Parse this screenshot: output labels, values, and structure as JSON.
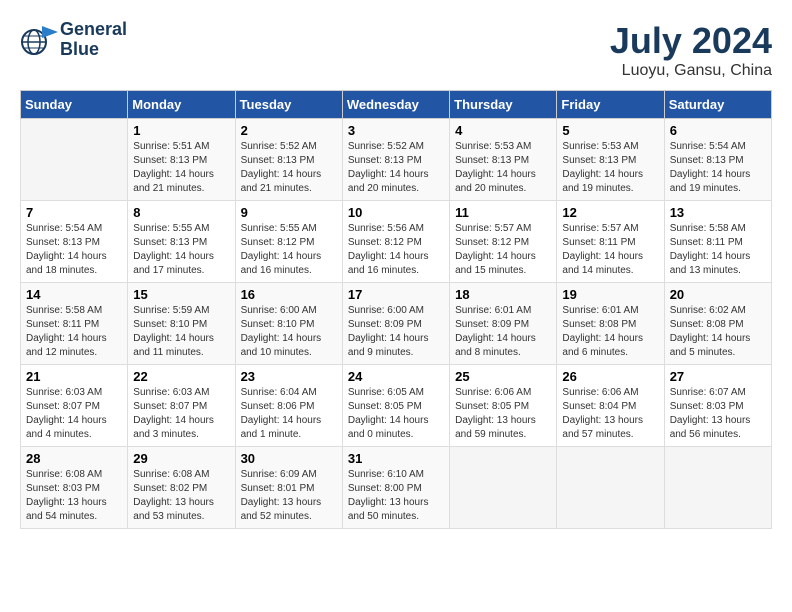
{
  "header": {
    "logo_line1": "General",
    "logo_line2": "Blue",
    "month": "July 2024",
    "location": "Luoyu, Gansu, China"
  },
  "weekdays": [
    "Sunday",
    "Monday",
    "Tuesday",
    "Wednesday",
    "Thursday",
    "Friday",
    "Saturday"
  ],
  "weeks": [
    [
      {
        "day": "",
        "info": ""
      },
      {
        "day": "1",
        "info": "Sunrise: 5:51 AM\nSunset: 8:13 PM\nDaylight: 14 hours\nand 21 minutes."
      },
      {
        "day": "2",
        "info": "Sunrise: 5:52 AM\nSunset: 8:13 PM\nDaylight: 14 hours\nand 21 minutes."
      },
      {
        "day": "3",
        "info": "Sunrise: 5:52 AM\nSunset: 8:13 PM\nDaylight: 14 hours\nand 20 minutes."
      },
      {
        "day": "4",
        "info": "Sunrise: 5:53 AM\nSunset: 8:13 PM\nDaylight: 14 hours\nand 20 minutes."
      },
      {
        "day": "5",
        "info": "Sunrise: 5:53 AM\nSunset: 8:13 PM\nDaylight: 14 hours\nand 19 minutes."
      },
      {
        "day": "6",
        "info": "Sunrise: 5:54 AM\nSunset: 8:13 PM\nDaylight: 14 hours\nand 19 minutes."
      }
    ],
    [
      {
        "day": "7",
        "info": "Sunrise: 5:54 AM\nSunset: 8:13 PM\nDaylight: 14 hours\nand 18 minutes."
      },
      {
        "day": "8",
        "info": "Sunrise: 5:55 AM\nSunset: 8:13 PM\nDaylight: 14 hours\nand 17 minutes."
      },
      {
        "day": "9",
        "info": "Sunrise: 5:55 AM\nSunset: 8:12 PM\nDaylight: 14 hours\nand 16 minutes."
      },
      {
        "day": "10",
        "info": "Sunrise: 5:56 AM\nSunset: 8:12 PM\nDaylight: 14 hours\nand 16 minutes."
      },
      {
        "day": "11",
        "info": "Sunrise: 5:57 AM\nSunset: 8:12 PM\nDaylight: 14 hours\nand 15 minutes."
      },
      {
        "day": "12",
        "info": "Sunrise: 5:57 AM\nSunset: 8:11 PM\nDaylight: 14 hours\nand 14 minutes."
      },
      {
        "day": "13",
        "info": "Sunrise: 5:58 AM\nSunset: 8:11 PM\nDaylight: 14 hours\nand 13 minutes."
      }
    ],
    [
      {
        "day": "14",
        "info": "Sunrise: 5:58 AM\nSunset: 8:11 PM\nDaylight: 14 hours\nand 12 minutes."
      },
      {
        "day": "15",
        "info": "Sunrise: 5:59 AM\nSunset: 8:10 PM\nDaylight: 14 hours\nand 11 minutes."
      },
      {
        "day": "16",
        "info": "Sunrise: 6:00 AM\nSunset: 8:10 PM\nDaylight: 14 hours\nand 10 minutes."
      },
      {
        "day": "17",
        "info": "Sunrise: 6:00 AM\nSunset: 8:09 PM\nDaylight: 14 hours\nand 9 minutes."
      },
      {
        "day": "18",
        "info": "Sunrise: 6:01 AM\nSunset: 8:09 PM\nDaylight: 14 hours\nand 8 minutes."
      },
      {
        "day": "19",
        "info": "Sunrise: 6:01 AM\nSunset: 8:08 PM\nDaylight: 14 hours\nand 6 minutes."
      },
      {
        "day": "20",
        "info": "Sunrise: 6:02 AM\nSunset: 8:08 PM\nDaylight: 14 hours\nand 5 minutes."
      }
    ],
    [
      {
        "day": "21",
        "info": "Sunrise: 6:03 AM\nSunset: 8:07 PM\nDaylight: 14 hours\nand 4 minutes."
      },
      {
        "day": "22",
        "info": "Sunrise: 6:03 AM\nSunset: 8:07 PM\nDaylight: 14 hours\nand 3 minutes."
      },
      {
        "day": "23",
        "info": "Sunrise: 6:04 AM\nSunset: 8:06 PM\nDaylight: 14 hours\nand 1 minute."
      },
      {
        "day": "24",
        "info": "Sunrise: 6:05 AM\nSunset: 8:05 PM\nDaylight: 14 hours\nand 0 minutes."
      },
      {
        "day": "25",
        "info": "Sunrise: 6:06 AM\nSunset: 8:05 PM\nDaylight: 13 hours\nand 59 minutes."
      },
      {
        "day": "26",
        "info": "Sunrise: 6:06 AM\nSunset: 8:04 PM\nDaylight: 13 hours\nand 57 minutes."
      },
      {
        "day": "27",
        "info": "Sunrise: 6:07 AM\nSunset: 8:03 PM\nDaylight: 13 hours\nand 56 minutes."
      }
    ],
    [
      {
        "day": "28",
        "info": "Sunrise: 6:08 AM\nSunset: 8:03 PM\nDaylight: 13 hours\nand 54 minutes."
      },
      {
        "day": "29",
        "info": "Sunrise: 6:08 AM\nSunset: 8:02 PM\nDaylight: 13 hours\nand 53 minutes."
      },
      {
        "day": "30",
        "info": "Sunrise: 6:09 AM\nSunset: 8:01 PM\nDaylight: 13 hours\nand 52 minutes."
      },
      {
        "day": "31",
        "info": "Sunrise: 6:10 AM\nSunset: 8:00 PM\nDaylight: 13 hours\nand 50 minutes."
      },
      {
        "day": "",
        "info": ""
      },
      {
        "day": "",
        "info": ""
      },
      {
        "day": "",
        "info": ""
      }
    ]
  ]
}
